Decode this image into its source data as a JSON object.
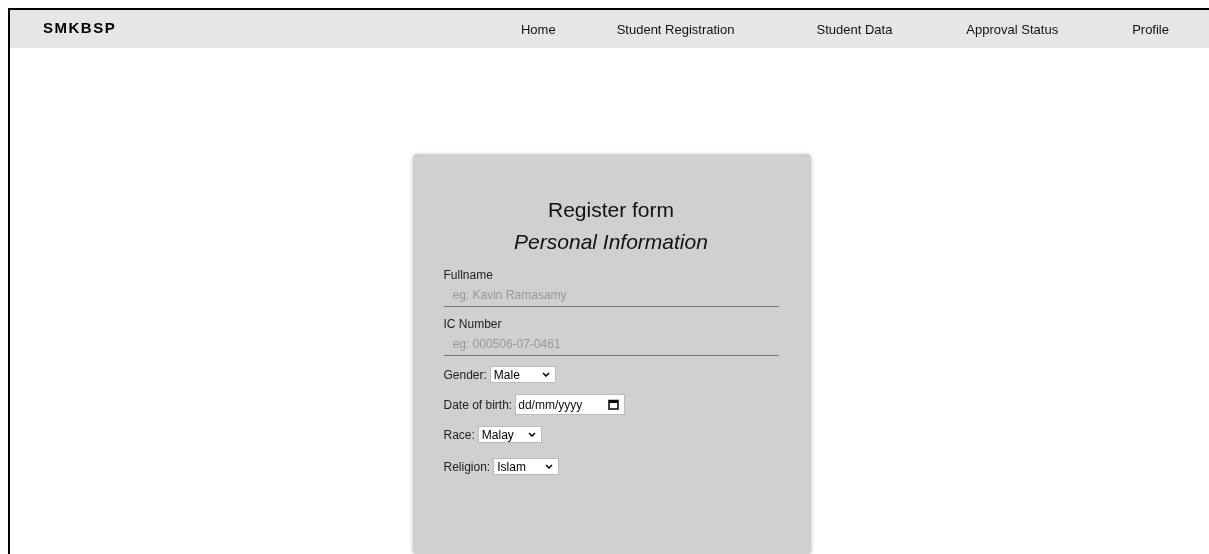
{
  "brand": "SMKBSP",
  "nav": [
    {
      "label": "Home"
    },
    {
      "label": "Student Registration"
    },
    {
      "label": "Student Data"
    },
    {
      "label": "Approval Status"
    },
    {
      "label": "Profile"
    }
  ],
  "form": {
    "title": "Register form",
    "subtitle": "Personal Information",
    "fields": [
      {
        "kind": "text",
        "label": "Fullname",
        "placeholder": "eg: Kavin Ramasamy"
      },
      {
        "kind": "text",
        "label": "IC Number",
        "placeholder": "eg: 000506-07-0461"
      },
      {
        "kind": "select",
        "label": "Gender:",
        "value": "Male"
      },
      {
        "kind": "date",
        "label": "Date of birth:",
        "placeholder": "dd/mm/yyyy"
      },
      {
        "kind": "select",
        "label": "Race:",
        "value": "Malay"
      },
      {
        "kind": "select",
        "label": "Religion:",
        "value": "Islam"
      }
    ]
  }
}
